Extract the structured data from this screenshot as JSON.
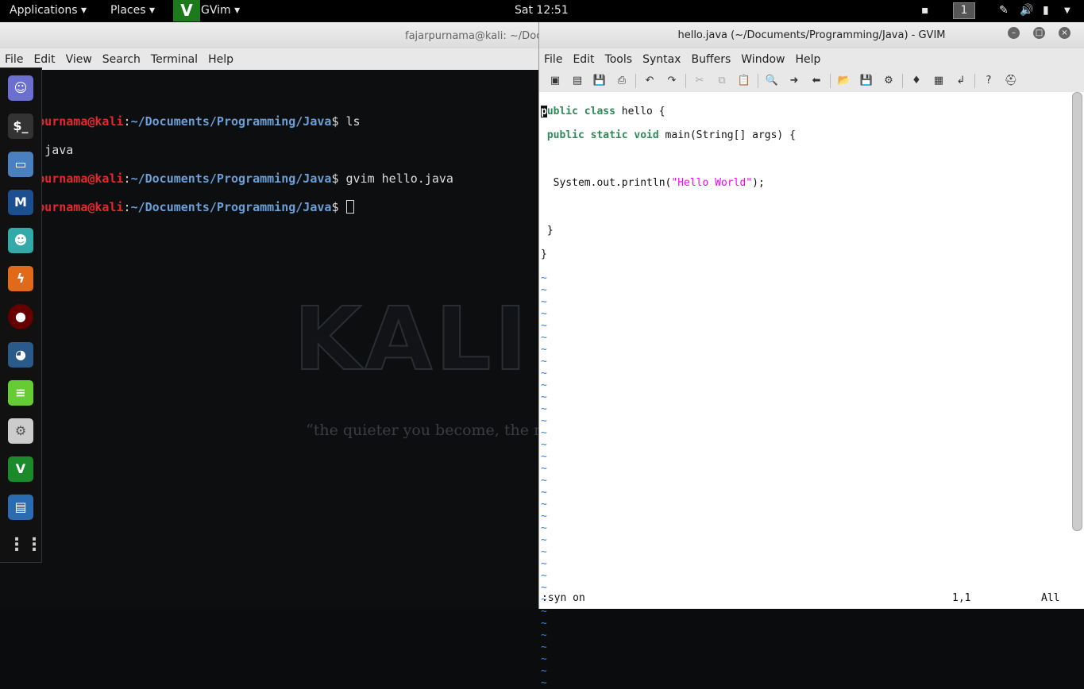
{
  "topbar": {
    "applications": "Applications ▾",
    "places": "Places ▾",
    "app": "GVim ▾",
    "clock": "Sat 12:51",
    "workspace": "1"
  },
  "terminal": {
    "title": "fajarpurnama@kali: ~/Documents/Programming/Java",
    "menu": [
      "File",
      "Edit",
      "View",
      "Search",
      "Terminal",
      "Help"
    ],
    "user": "fajarpurnama@kali",
    "path": "~/Documents/Programming/Java",
    "lines": [
      {
        "cmd": " ls"
      },
      {
        "cmd": " gvim hello.java"
      },
      {
        "cmd": " "
      }
    ],
    "output": "hello.java"
  },
  "background": {
    "logo": "KALI LINUX",
    "quote": "“the quieter you become, the more you are able to hear”"
  },
  "gvim": {
    "title": "hello.java (~/Documents/Programming/Java) - GVIM",
    "menu": [
      "File",
      "Edit",
      "Tools",
      "Syntax",
      "Buffers",
      "Window",
      "Help"
    ],
    "code": {
      "l1a": "public class",
      "l1b": " hello {",
      "l2a": "public static void",
      "l2b": " main(String[] args) {",
      "l3a": "  System.out.println(",
      "l3s": "\"Hello World\"",
      "l3b": ");",
      "l4": " }",
      "l5": "}"
    },
    "tilde": "~",
    "command": ":syn on",
    "position": "1,1",
    "scroll": "All"
  }
}
